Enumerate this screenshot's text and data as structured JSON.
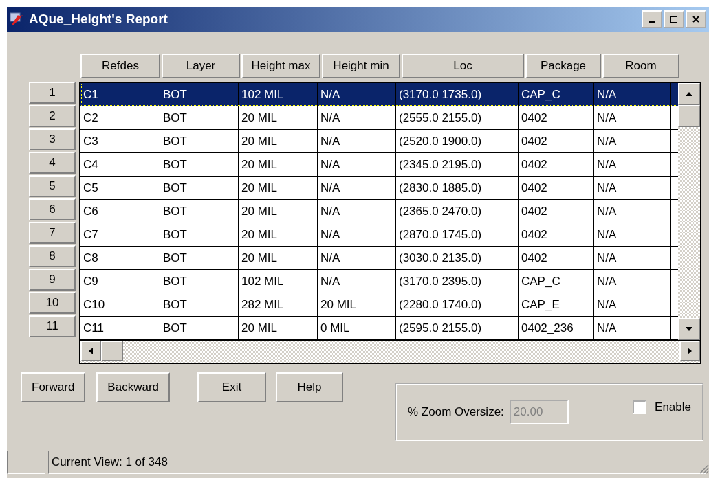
{
  "window": {
    "title": "AQue_Height's Report"
  },
  "table": {
    "columns": [
      "Refdes",
      "Layer",
      "Height max",
      "Height min",
      "Loc",
      "Package",
      "Room"
    ],
    "rows": [
      {
        "number": "1",
        "selected": true,
        "cells": [
          "C1",
          "BOT",
          "102 MIL",
          "N/A",
          "(3170.0 1735.0)",
          "CAP_C",
          "N/A"
        ]
      },
      {
        "number": "2",
        "selected": false,
        "cells": [
          "C2",
          "BOT",
          "20 MIL",
          "N/A",
          "(2555.0 2155.0)",
          "0402",
          "N/A"
        ]
      },
      {
        "number": "3",
        "selected": false,
        "cells": [
          "C3",
          "BOT",
          "20 MIL",
          "N/A",
          "(2520.0 1900.0)",
          "0402",
          "N/A"
        ]
      },
      {
        "number": "4",
        "selected": false,
        "cells": [
          "C4",
          "BOT",
          "20 MIL",
          "N/A",
          "(2345.0 2195.0)",
          "0402",
          "N/A"
        ]
      },
      {
        "number": "5",
        "selected": false,
        "cells": [
          "C5",
          "BOT",
          "20 MIL",
          "N/A",
          "(2830.0 1885.0)",
          "0402",
          "N/A"
        ]
      },
      {
        "number": "6",
        "selected": false,
        "cells": [
          "C6",
          "BOT",
          "20 MIL",
          "N/A",
          "(2365.0 2470.0)",
          "0402",
          "N/A"
        ]
      },
      {
        "number": "7",
        "selected": false,
        "cells": [
          "C7",
          "BOT",
          "20 MIL",
          "N/A",
          "(2870.0 1745.0)",
          "0402",
          "N/A"
        ]
      },
      {
        "number": "8",
        "selected": false,
        "cells": [
          "C8",
          "BOT",
          "20 MIL",
          "N/A",
          "(3030.0 2135.0)",
          "0402",
          "N/A"
        ]
      },
      {
        "number": "9",
        "selected": false,
        "cells": [
          "C9",
          "BOT",
          "102 MIL",
          "N/A",
          "(3170.0 2395.0)",
          "CAP_C",
          "N/A"
        ]
      },
      {
        "number": "10",
        "selected": false,
        "cells": [
          "C10",
          "BOT",
          "282 MIL",
          "20 MIL",
          "(2280.0 1740.0)",
          "CAP_E",
          "N/A"
        ]
      },
      {
        "number": "11",
        "selected": false,
        "cells": [
          "C11",
          "BOT",
          "20 MIL",
          "0 MIL",
          "(2595.0 2155.0)",
          "0402_236",
          "N/A"
        ]
      }
    ]
  },
  "buttons": [
    "Forward",
    "Backward",
    "Exit",
    "Help"
  ],
  "zoom": {
    "label": "% Zoom Oversize:",
    "value": "20.00",
    "disabled": true,
    "enable_label": "Enable",
    "enable_checked": false
  },
  "status_bar": {
    "text": "Current View: 1 of 348"
  }
}
